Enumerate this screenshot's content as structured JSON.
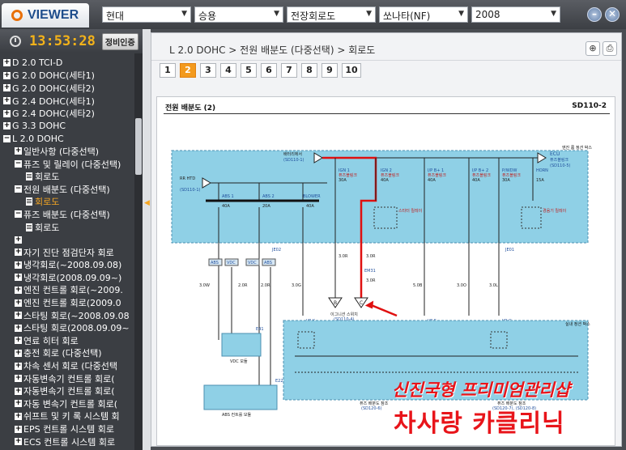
{
  "app": {
    "logo": "VIEWER"
  },
  "selectors": [
    {
      "id": "maker",
      "value": "현대"
    },
    {
      "id": "type",
      "value": "승용"
    },
    {
      "id": "category",
      "value": "전장회로도"
    },
    {
      "id": "model",
      "value": "쏘나타(NF)"
    },
    {
      "id": "year",
      "value": "2008"
    }
  ],
  "window_buttons": {
    "minimize": "–",
    "close": "✕"
  },
  "clock": {
    "time": "13:53:28",
    "cert_label": "정비인증"
  },
  "tree": [
    {
      "icon": "plus",
      "label": "D 2.0 TCI-D",
      "indent": 0
    },
    {
      "icon": "plus",
      "label": "G 2.0 DOHC(세타1)",
      "indent": 0
    },
    {
      "icon": "plus",
      "label": "G 2.0 DOHC(세타2)",
      "indent": 0
    },
    {
      "icon": "plus",
      "label": "G 2.4 DOHC(세타1)",
      "indent": 0
    },
    {
      "icon": "plus",
      "label": "G 2.4 DOHC(세타2)",
      "indent": 0
    },
    {
      "icon": "plus",
      "label": "G 3.3 DOHC",
      "indent": 0
    },
    {
      "icon": "minus",
      "label": "L 2.0 DOHC",
      "indent": 0
    },
    {
      "icon": "plus",
      "label": "일반사항 (다중선택)",
      "indent": 1
    },
    {
      "icon": "minus",
      "label": "퓨즈 및 릴레이 (다중선택)",
      "indent": 1
    },
    {
      "icon": "doc",
      "label": "회로도",
      "indent": 2
    },
    {
      "icon": "minus",
      "label": "전원 배분도 (다중선택)",
      "indent": 1
    },
    {
      "icon": "doc",
      "label": "회로도",
      "indent": 2,
      "highlight": true
    },
    {
      "icon": "minus",
      "label": "퓨즈 배분도 (다중선택)",
      "indent": 1
    },
    {
      "icon": "doc",
      "label": "회로도",
      "indent": 2
    },
    {
      "icon": "plus",
      "label": "",
      "indent": 1
    },
    {
      "icon": "plus",
      "label": "자기 진단 점검단자 회로",
      "indent": 1
    },
    {
      "icon": "plus",
      "label": "냉각회로(~2008.09.08)",
      "indent": 1
    },
    {
      "icon": "plus",
      "label": "냉각회로(2008.09.09~)",
      "indent": 1
    },
    {
      "icon": "plus",
      "label": "엔진 컨트롤 회로(~2009.",
      "indent": 1
    },
    {
      "icon": "plus",
      "label": "엔진 컨트롤 회로(2009.0",
      "indent": 1
    },
    {
      "icon": "plus",
      "label": "스타팅 회로(~2008.09.08",
      "indent": 1
    },
    {
      "icon": "plus",
      "label": "스타팅 회로(2008.09.09~",
      "indent": 1
    },
    {
      "icon": "plus",
      "label": "연료 히터 회로",
      "indent": 1
    },
    {
      "icon": "plus",
      "label": "충전 회로 (다중선택)",
      "indent": 1
    },
    {
      "icon": "plus",
      "label": "차속 센서 회로 (다중선택",
      "indent": 1
    },
    {
      "icon": "plus",
      "label": "자동변속기 컨트롤 회로(",
      "indent": 1
    },
    {
      "icon": "plus",
      "label": "자동변속기 컨트롤 회로(",
      "indent": 1
    },
    {
      "icon": "plus",
      "label": "자동 변속기 컨트롤 회로(",
      "indent": 1
    },
    {
      "icon": "plus",
      "label": "쉬프트 및 키 록 시스템 회",
      "indent": 1
    },
    {
      "icon": "plus",
      "label": "EPS 컨트롤 시스템 회로",
      "indent": 1
    },
    {
      "icon": "plus",
      "label": "ECS 컨트롤 시스템 회로",
      "indent": 1
    }
  ],
  "breadcrumb": "L 2.0 DOHC > 전원 배분도 (다중선택) > 회로도",
  "toolbar": {
    "zoom_icon": "zoom-in-icon",
    "print_icon": "print-icon"
  },
  "pages": [
    "1",
    "2",
    "3",
    "4",
    "5",
    "6",
    "7",
    "8",
    "9",
    "10"
  ],
  "active_page": "2",
  "document": {
    "title": "전원 배분도 (2)",
    "code": "SD110-2",
    "labels": {
      "battery": "배터리에서",
      "ref1": "(SD110-1)",
      "ecu": "ECU",
      "ecu_fuse": "퓨즈블링크",
      "ecu_refs": "(SD110-5)",
      "rr_htd": "RR HTD",
      "ign1": "IGN 1",
      "ign2": "IGN 2",
      "ipb1": "I/P B+ 1",
      "ipb2": "I/P B+ 2",
      "pwdw": "P/WDW",
      "horn": "HORN",
      "abs1": "ABS 1",
      "abs2": "ABS 2",
      "blower": "BLOWER",
      "fuse_sub": "퓨즈블링크",
      "a40": "40A",
      "a30": "30A",
      "a20": "20A",
      "a15": "15A",
      "starter_relay": "스타터 릴레이",
      "horn_relay": "경음기 릴레이",
      "engine_room_box": "엔진 룸 정션 박스",
      "ign_switch": "이그니션 스위치",
      "ign_ref": "(SD110-4)",
      "vdc_module": "VDC 모듈",
      "abs_module": "ABS 컨트롤 모듈",
      "ip_junction": "실내 정션 박스",
      "ip_fuse_ref1": "퓨즈 배분도 참조",
      "ip_fuse_ref1_code": "(SD120-6)",
      "ip_fuse_ref2": "퓨즈 배분도 참조",
      "ip_fuse_ref2_code": "(SD120-7), (SD120-8)",
      "connector_ipk": "I/P-K",
      "connector_ipf": "I/P-F",
      "connector_ipg": "I/P-G",
      "connector_em31": "EM31",
      "connector_je02": "JE02",
      "connector_je01": "JE01",
      "connector_e41": "E41",
      "connector_e22": "E22",
      "wire_30w": "3.0W",
      "wire_20r": "2.0R",
      "wire_30g": "3.0G",
      "wire_30r": "3.0R",
      "wire_50b": "5.0B",
      "wire_30o": "3.0O",
      "wire_30l": "3.0L",
      "tag_abs": "ABS",
      "tag_vdc": "VDC",
      "term_b": "B",
      "term_c": "C"
    }
  },
  "watermark": {
    "line1": "신진국형 프리미엄관리샵",
    "line2": "차사랑 카클리닉"
  }
}
